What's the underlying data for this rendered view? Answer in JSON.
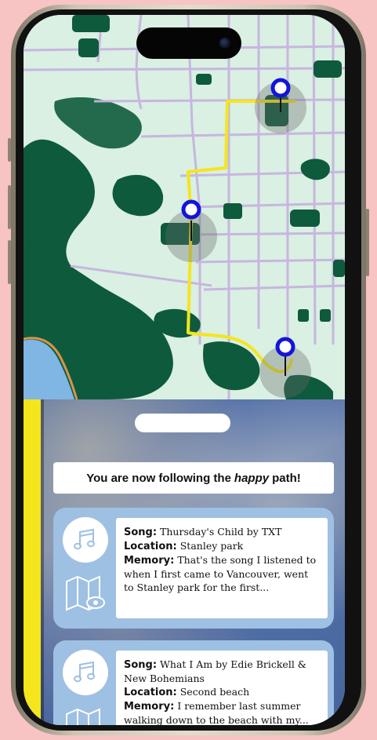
{
  "banner": {
    "prefix": "You are now following the",
    "emphasis": "happy",
    "suffix": "path!"
  },
  "labels": {
    "song": "Song:",
    "location": "Location:",
    "memory": "Memory:"
  },
  "memories": [
    {
      "song": "Thursday's Child by TXT",
      "location": "Stanley park",
      "memory": "That's the song I listened to when I first came to Vancouver, went to Stanley park for the first..."
    },
    {
      "song": "What I Am by Edie Brickell & New Bohemians",
      "location": "Second beach",
      "memory": "I remember last summer walking down to the beach with my..."
    }
  ],
  "icons": {
    "music": "music-note-icon",
    "map": "map-view-icon",
    "pin": "location-pin-icon"
  },
  "colors": {
    "background": "#f8c3c3",
    "route": "#f5e51c",
    "pin": "#1414d8",
    "card": "#9ec0e2",
    "park": "#0e5a3c",
    "land": "#d9f0e2",
    "road": "#c7b3df"
  }
}
